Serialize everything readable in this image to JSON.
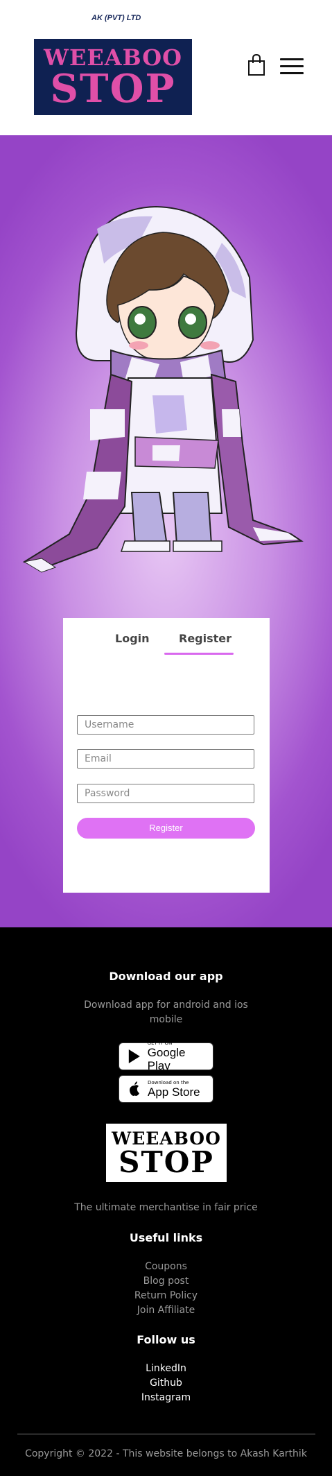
{
  "header": {
    "company": "AK (PVT) LTD",
    "logo_line1": "WEEABOO",
    "logo_line2": "STOP",
    "cart_icon": "shopping-bag-icon",
    "menu_icon": "hamburger-menu-icon"
  },
  "hero": {
    "character_icon": "anime-character-illustration"
  },
  "auth": {
    "tabs": [
      {
        "label": "Login"
      },
      {
        "label": "Register"
      }
    ],
    "active_tab": "Register",
    "username_placeholder": "Username",
    "email_placeholder": "Email",
    "password_placeholder": "Password",
    "submit_label": "Register",
    "accent": "#df72f4"
  },
  "footer": {
    "download_title": "Download our app",
    "download_text_line1": "Download app for android and ios",
    "download_text_line2": "mobile",
    "google_play": {
      "small": "GET IT ON",
      "big": "Google Play"
    },
    "app_store": {
      "small": "Download on the",
      "big": "App Store"
    },
    "logo_line1": "WEEABOO",
    "logo_line2": "STOP",
    "tagline": "The ultimate merchantise in fair price",
    "useful_title": "Useful links",
    "useful_links": [
      "Coupons",
      "Blog post",
      "Return Policy",
      "Join Affiliate"
    ],
    "follow_title": "Follow us",
    "follow_links": [
      "LinkedIn",
      "Github",
      "Instagram"
    ],
    "copyright": "Copyright © 2022 - This website belongs to Akash Karthik"
  }
}
